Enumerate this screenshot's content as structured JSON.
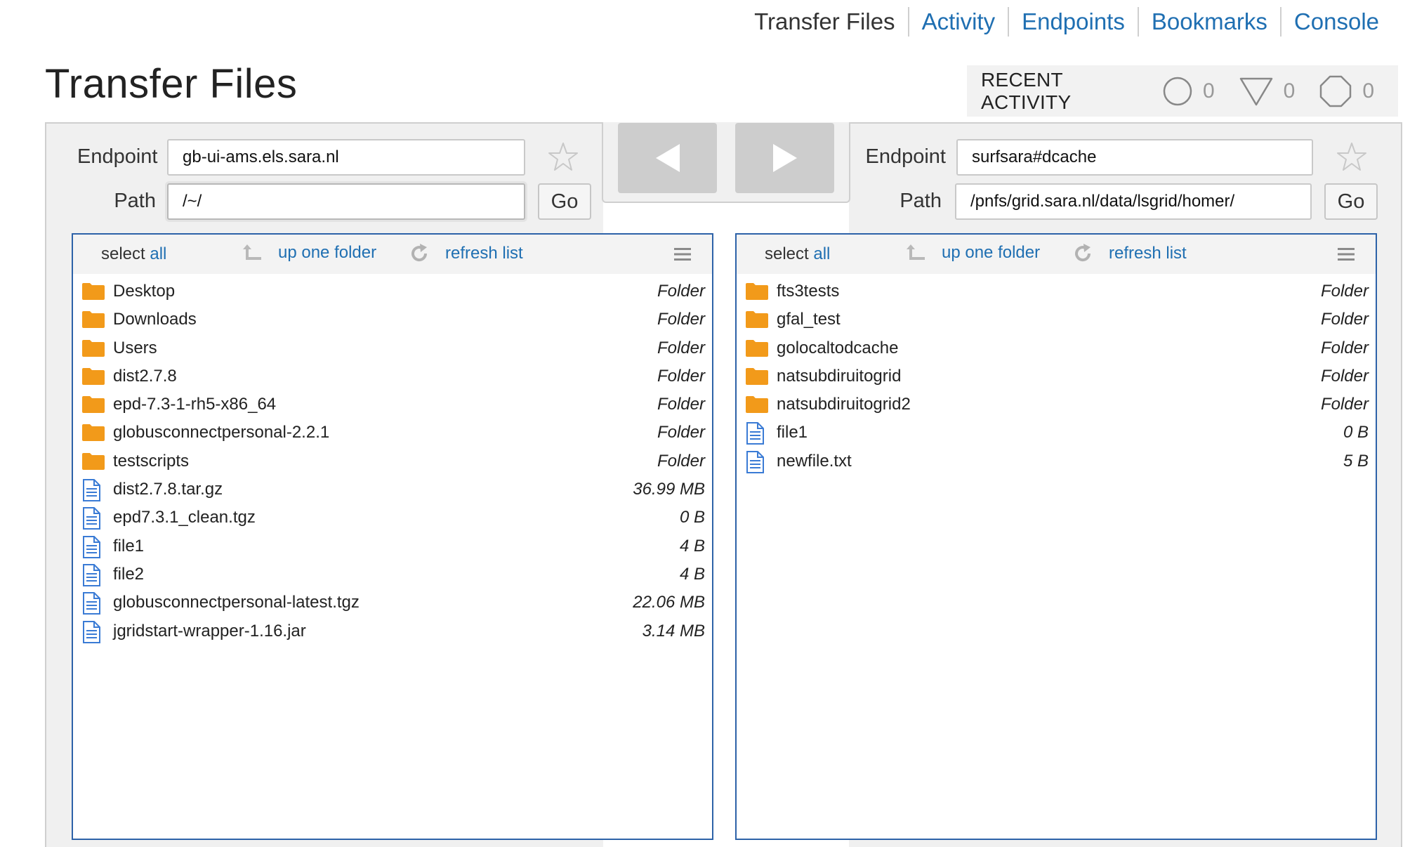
{
  "nav": {
    "items": [
      "Transfer Files",
      "Activity",
      "Endpoints",
      "Bookmarks",
      "Console"
    ]
  },
  "page": {
    "title": "Transfer Files"
  },
  "recent_activity": {
    "label": "RECENT ACTIVITY",
    "active_count": "0",
    "succeeded_count": "0",
    "failed_count": "0"
  },
  "labels": {
    "endpoint": "Endpoint",
    "path": "Path",
    "go": "Go",
    "select": "select",
    "all": "all",
    "up_one_folder": "up one folder",
    "refresh_list": "refresh list"
  },
  "left": {
    "endpoint": "gb-ui-ams.els.sara.nl",
    "path": "/~/",
    "files": [
      {
        "name": "Desktop",
        "size": "Folder",
        "type": "folder"
      },
      {
        "name": "Downloads",
        "size": "Folder",
        "type": "folder"
      },
      {
        "name": "Users",
        "size": "Folder",
        "type": "folder"
      },
      {
        "name": "dist2.7.8",
        "size": "Folder",
        "type": "folder"
      },
      {
        "name": "epd-7.3-1-rh5-x86_64",
        "size": "Folder",
        "type": "folder"
      },
      {
        "name": "globusconnectpersonal-2.2.1",
        "size": "Folder",
        "type": "folder"
      },
      {
        "name": "testscripts",
        "size": "Folder",
        "type": "folder"
      },
      {
        "name": "dist2.7.8.tar.gz",
        "size": "36.99 MB",
        "type": "file"
      },
      {
        "name": "epd7.3.1_clean.tgz",
        "size": "0 B",
        "type": "file"
      },
      {
        "name": "file1",
        "size": "4 B",
        "type": "file"
      },
      {
        "name": "file2",
        "size": "4 B",
        "type": "file"
      },
      {
        "name": "globusconnectpersonal-latest.tgz",
        "size": "22.06 MB",
        "type": "file"
      },
      {
        "name": "jgridstart-wrapper-1.16.jar",
        "size": "3.14 MB",
        "type": "file"
      }
    ]
  },
  "right": {
    "endpoint": "surfsara#dcache",
    "path": "/pnfs/grid.sara.nl/data/lsgrid/homer/",
    "files": [
      {
        "name": "fts3tests",
        "size": "Folder",
        "type": "folder"
      },
      {
        "name": "gfal_test",
        "size": "Folder",
        "type": "folder"
      },
      {
        "name": "golocaltodcache",
        "size": "Folder",
        "type": "folder"
      },
      {
        "name": "natsubdiruitogrid",
        "size": "Folder",
        "type": "folder"
      },
      {
        "name": "natsubdiruitogrid2",
        "size": "Folder",
        "type": "folder"
      },
      {
        "name": "file1",
        "size": "0 B",
        "type": "file"
      },
      {
        "name": "newfile.txt",
        "size": "5 B",
        "type": "file"
      }
    ]
  },
  "colors": {
    "link": "#1f6fb2",
    "folder": "#f29a1a",
    "file_icon": "#3a7bd5",
    "list_border": "#2d62a8"
  }
}
